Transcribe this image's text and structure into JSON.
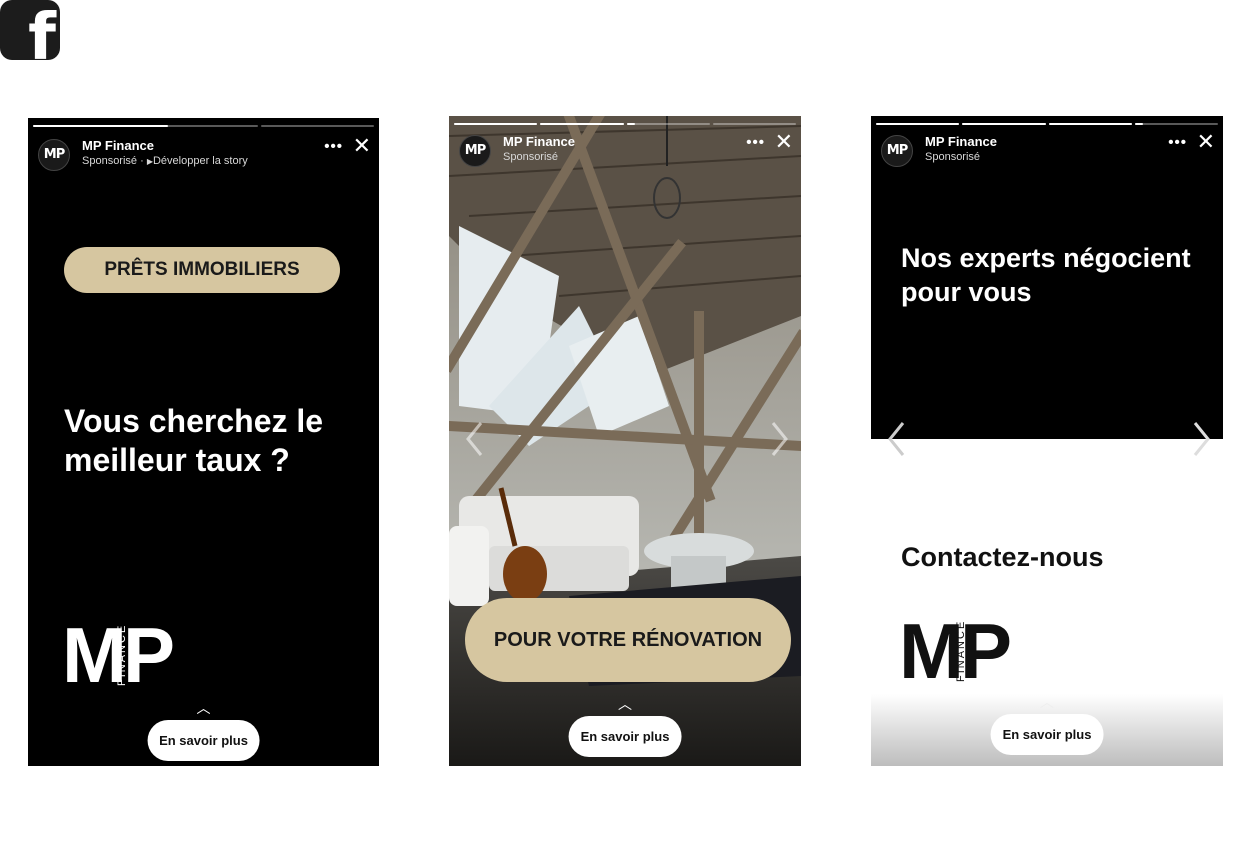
{
  "platform": {
    "icon": "facebook-icon",
    "glyph": "f"
  },
  "stories": [
    {
      "account": "MP Finance",
      "avatar_text": "MP",
      "sponsored": "Sponsorisé ·",
      "expand_icon": "play-icon",
      "expand_label": "Développer la story",
      "menu_icon": "more-dots-icon",
      "close_icon": "close-icon",
      "progress": [
        0.6,
        0,
        0
      ],
      "tag": "PRÊTS IMMOBILIERS",
      "headline": "Vous cherchez le meilleur taux ?",
      "logo_letters": "MP",
      "logo_sub": "FINANCE",
      "cta": "En savoir plus",
      "cta_icon": "chevron-up-icon"
    },
    {
      "account": "MP Finance",
      "avatar_text": "MP",
      "sponsored": "Sponsorisé",
      "menu_icon": "more-dots-icon",
      "close_icon": "close-icon",
      "progress": [
        1,
        1,
        0.1,
        0
      ],
      "tag": "POUR VOTRE RÉNOVATION",
      "cta": "En savoir plus",
      "cta_icon": "chevron-up-icon"
    },
    {
      "account": "MP Finance",
      "avatar_text": "MP",
      "sponsored": "Sponsorisé",
      "menu_icon": "more-dots-icon",
      "close_icon": "close-icon",
      "progress": [
        1,
        1,
        1,
        0.1
      ],
      "headline": "Nos experts négocient pour vous",
      "subheadline": "Contactez-nous",
      "logo_letters": "MP",
      "logo_sub": "FINANCE",
      "cta": "En savoir plus",
      "cta_icon": "chevron-up-icon"
    }
  ],
  "colors": {
    "tag_bg": "#d6c6a0",
    "story_bg": "#000000",
    "cta_bg": "#ffffff"
  }
}
